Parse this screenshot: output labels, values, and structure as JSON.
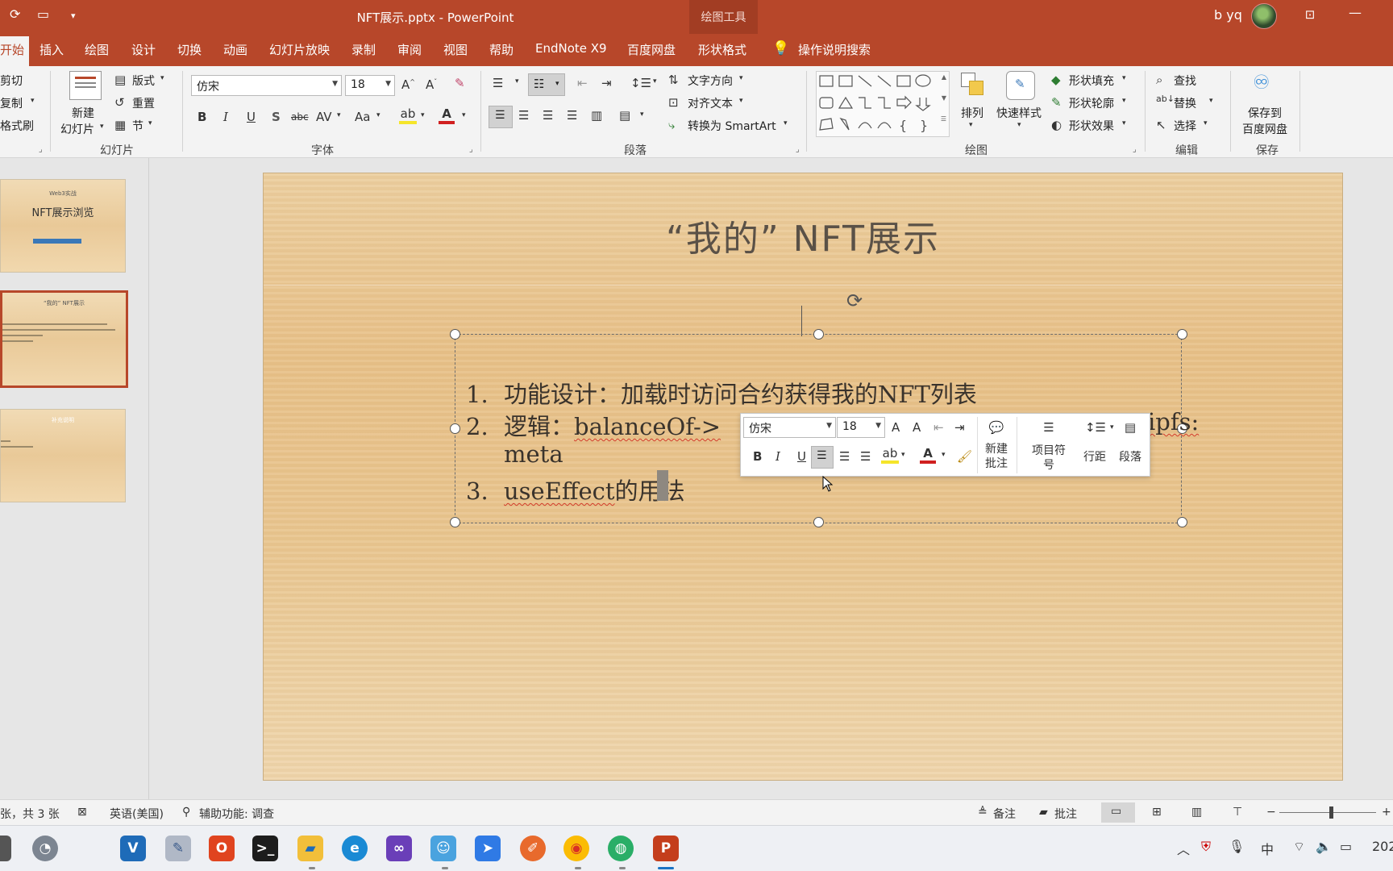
{
  "app": {
    "document_title": "NFT展示.pptx  -  PowerPoint",
    "contextual_tab_group": "绘图工具",
    "user_name": "b yq"
  },
  "tabs": [
    {
      "label": "开始",
      "active": true
    },
    {
      "label": "插入"
    },
    {
      "label": "绘图"
    },
    {
      "label": "设计"
    },
    {
      "label": "切换"
    },
    {
      "label": "动画"
    },
    {
      "label": "幻灯片放映"
    },
    {
      "label": "录制"
    },
    {
      "label": "审阅"
    },
    {
      "label": "视图"
    },
    {
      "label": "帮助"
    },
    {
      "label": "EndNote X9"
    },
    {
      "label": "百度网盘"
    },
    {
      "label": "形状格式"
    }
  ],
  "tell_me": "操作说明搜索",
  "ribbon": {
    "clipboard": {
      "cut": "剪切",
      "copy": "复制",
      "format_painter": "格式刷"
    },
    "slides": {
      "new_slide_line1": "新建",
      "new_slide_line2": "幻灯片",
      "layout": "版式",
      "reset": "重置",
      "section": "节",
      "label": "幻灯片"
    },
    "font": {
      "family": "仿宋",
      "size": "18",
      "label": "字体"
    },
    "paragraph": {
      "text_direction": "文字方向",
      "align_text": "对齐文本",
      "smartart": "转换为 SmartArt",
      "label": "段落"
    },
    "drawing": {
      "arrange": "排列",
      "quick_styles": "快速样式",
      "shape_fill": "形状填充",
      "shape_outline": "形状轮廓",
      "shape_effects": "形状效果",
      "label": "绘图"
    },
    "editing": {
      "find": "查找",
      "replace": "替换",
      "select": "选择",
      "label": "编辑"
    },
    "save": {
      "baidu_line1": "保存到",
      "baidu_line2": "百度网盘",
      "label": "保存"
    }
  },
  "thumbnails": [
    {
      "subtitle": "Web3实战",
      "title": "NFT展示浏览"
    },
    {
      "title": "“我的” NFT展示"
    },
    {
      "title": "补充说明"
    }
  ],
  "slide": {
    "title": "“我的” NFT展示",
    "items": [
      {
        "num": "1.",
        "text": "功能设计：加载时访问合约获得我的NFT列表"
      },
      {
        "num": "2.",
        "prefix": "逻辑：",
        "code": "balanceOf->",
        "tail": "ipfs:"
      },
      {
        "num": "",
        "text": "meta"
      },
      {
        "num": "3.",
        "code": "useEffect",
        "text": "的用法"
      }
    ]
  },
  "mini_toolbar": {
    "font": "仿宋",
    "size": "18",
    "new_comment_line1": "新建",
    "new_comment_line2": "批注",
    "bullets_line1": "项目符",
    "bullets_line2": "号",
    "line_spacing": "行距",
    "paragraph": "段落"
  },
  "statusbar": {
    "slide_info": "张，共 3 张",
    "language": "英语(美国)",
    "accessibility": "辅助功能: 调查",
    "notes": "备注",
    "comments": "批注"
  },
  "taskbar": {
    "ime": "中",
    "clock_partial": "202"
  },
  "colors": {
    "accent": "#b7472a",
    "ribbon_bg": "#f3f3f3",
    "squiggle": "#d23a2a"
  }
}
